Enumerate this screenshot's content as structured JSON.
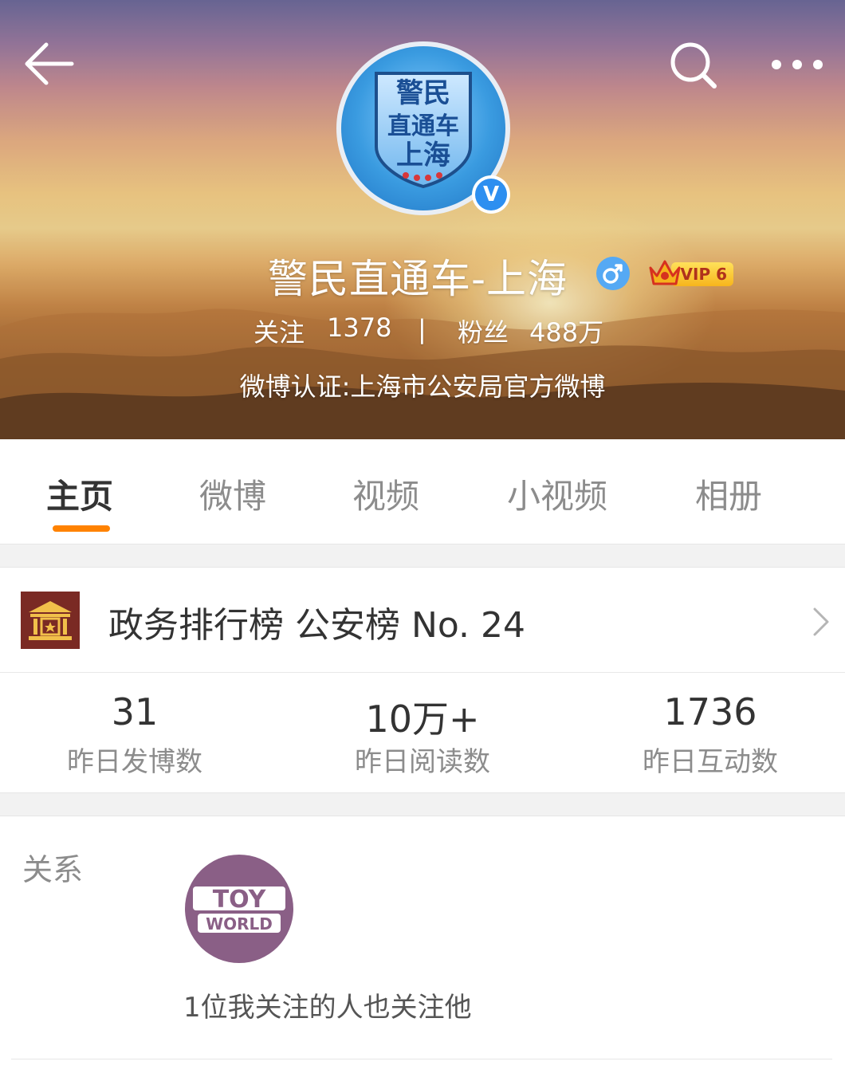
{
  "header": {
    "user_name": "警民直通车-上海",
    "avatar_lines": [
      "警民",
      "直通车",
      "上海"
    ],
    "verified_mark": "V",
    "vip_label": "VIP 6",
    "follow_label": "关注",
    "follow_count": "1378",
    "separator": "|",
    "fans_label": "粉丝",
    "fans_count": "488万",
    "certification": "微博认证:上海市公安局官方微博",
    "icons": {
      "back": "back-arrow-icon",
      "search": "search-icon",
      "more": "more-dots-icon",
      "gender": "male-icon",
      "vip": "vip-crown-icon"
    }
  },
  "tabs": [
    {
      "label": "主页",
      "active": true
    },
    {
      "label": "微博",
      "active": false
    },
    {
      "label": "视频",
      "active": false
    },
    {
      "label": "小视频",
      "active": false
    },
    {
      "label": "相册",
      "active": false
    }
  ],
  "rank": {
    "text": "政务排行榜 公安榜 No. 24",
    "icon": "government-building-icon"
  },
  "stats": [
    {
      "value": "31",
      "label": "昨日发博数"
    },
    {
      "value": "10万+",
      "label": "昨日阅读数"
    },
    {
      "value": "1736",
      "label": "昨日互动数"
    }
  ],
  "relation": {
    "title": "关系",
    "avatar_line1": "TOY",
    "avatar_line2": "WORLD",
    "description": "1位我关注的人也关注他"
  },
  "colors": {
    "accent_orange": "#ff8200",
    "verified_blue": "#2d8ff0",
    "rank_icon_bg": "#7a2a24",
    "toy_avatar_bg": "#8a5f86"
  }
}
